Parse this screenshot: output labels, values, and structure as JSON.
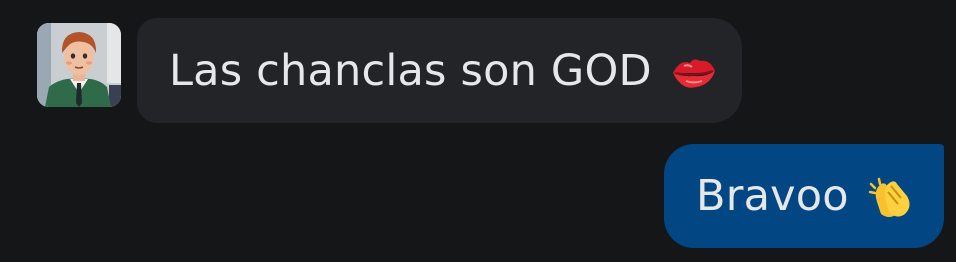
{
  "messages": [
    {
      "direction": "incoming",
      "text": "Las chanclas son GOD",
      "emoji": "kiss-lips-icon",
      "bubble_color": "#222428"
    },
    {
      "direction": "outgoing",
      "text": "Bravoo",
      "emoji": "clapping-hands-icon",
      "bubble_color": "#024783"
    }
  ],
  "colors": {
    "background": "#151618",
    "text": "#e6e7e9"
  }
}
